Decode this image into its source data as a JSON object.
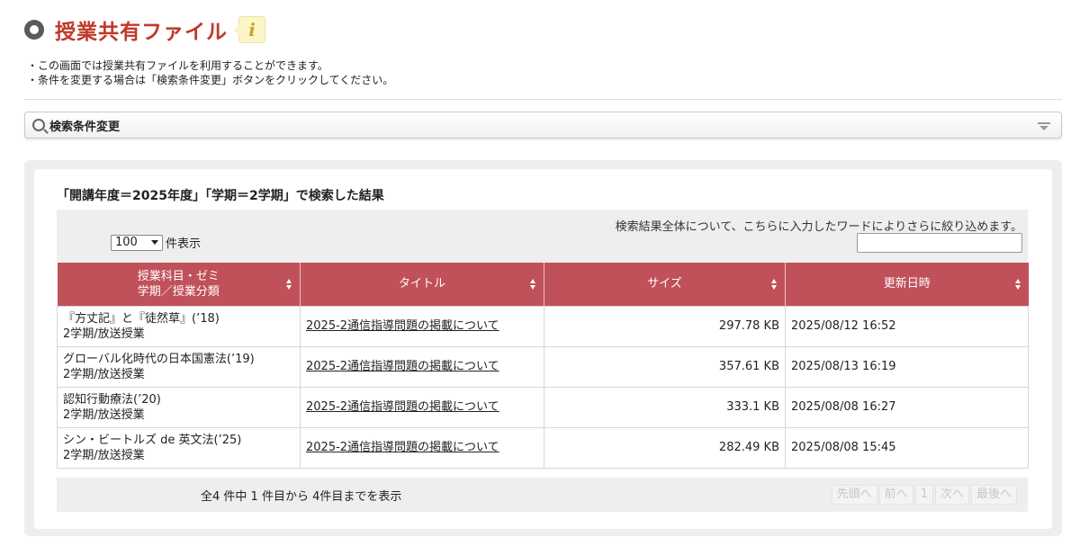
{
  "header": {
    "title": "授業共有ファイル",
    "info_icon": "i"
  },
  "description": [
    "・この画面では授業共有ファイルを利用することができます。",
    "・条件を変更する場合は「検索条件変更」ボタンをクリックしてください。"
  ],
  "search_bar": {
    "label": "検索条件変更"
  },
  "results": {
    "title": "「開講年度＝2025年度」「学期＝2学期」で検索した結果",
    "filter_text": "検索結果全体について、こちらに入力したワードによりさらに絞り込めます。",
    "filter_value": "",
    "per_page_value": "100",
    "per_page_label": "件表示",
    "columns": [
      {
        "line1": "授業科目・ゼミ",
        "line2": "学期／授業分類"
      },
      {
        "line1": "タイトル",
        "line2": ""
      },
      {
        "line1": "サイズ",
        "line2": ""
      },
      {
        "line1": "更新日時",
        "line2": ""
      }
    ],
    "rows": [
      {
        "course": "『方丈記』と『徒然草』(’18)",
        "term": "2学期/放送授業",
        "title": "2025-2通信指導問題の掲載について",
        "size": "297.78 KB",
        "date": "2025/08/12 16:52"
      },
      {
        "course": "グローバル化時代の日本国憲法(’19)",
        "term": "2学期/放送授業",
        "title": "2025-2通信指導問題の掲載について",
        "size": "357.61 KB",
        "date": "2025/08/13 16:19"
      },
      {
        "course": "認知行動療法(’20)",
        "term": "2学期/放送授業",
        "title": "2025-2通信指導問題の掲載について",
        "size": "333.1 KB",
        "date": "2025/08/08 16:27"
      },
      {
        "course": "シン・ビートルズ de 英文法(’25)",
        "term": "2学期/放送授業",
        "title": "2025-2通信指導問題の掲載について",
        "size": "282.49 KB",
        "date": "2025/08/08 15:45"
      }
    ],
    "footer_count": "全4 件中 1 件目から 4件目までを表示",
    "pager": [
      "先頭へ",
      "前へ",
      "1",
      "次へ",
      "最後へ"
    ]
  },
  "colors": {
    "title_red": "#c0392b",
    "header_red": "#c0505a"
  }
}
